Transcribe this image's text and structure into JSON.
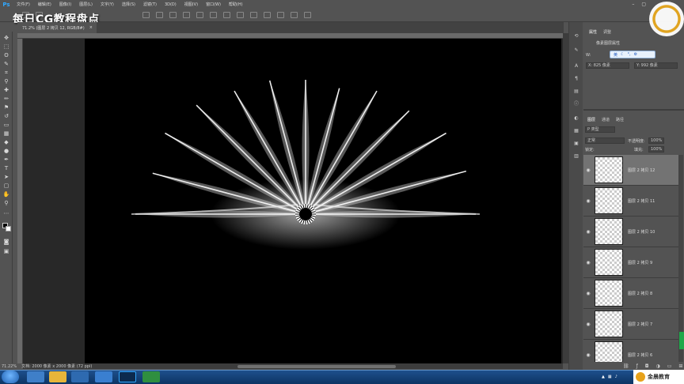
{
  "watermark": "每日CG教程盘点",
  "menubar": {
    "app_icon": "Ps",
    "items": [
      "文件(F)",
      "编辑(E)",
      "图像(I)",
      "图层(L)",
      "文字(Y)",
      "选择(S)",
      "滤镜(T)",
      "3D(D)",
      "视图(V)",
      "窗口(W)",
      "帮助(H)"
    ]
  },
  "document_tab": {
    "title": "71.2% (图层 2 拷贝 12, RGB/8#)",
    "close": "×"
  },
  "statusbar": {
    "zoom": "71.22%",
    "doc_size": "文档: 2000 像素 x 2000 像素 (72 ppi)"
  },
  "properties_panel": {
    "tabs": [
      "属性",
      "调整"
    ],
    "title": "像素图层属性",
    "w_label": "W:",
    "x_value": "X: 825 像素",
    "y_value": "Y: 992 像素"
  },
  "ime_bar": {
    "label": "英"
  },
  "layers_panel": {
    "tabs": [
      "图层",
      "通道",
      "路径"
    ],
    "filter": "P 类型",
    "blend_mode": "正常",
    "opacity_label": "不透明度:",
    "opacity_value": "100%",
    "lock_label": "锁定:",
    "fill_label": "填充:",
    "fill_value": "100%",
    "layers": [
      {
        "name": "图层 2 拷贝 12",
        "selected": true
      },
      {
        "name": "图层 2 拷贝 11",
        "selected": false
      },
      {
        "name": "图层 2 拷贝 10",
        "selected": false
      },
      {
        "name": "图层 2 拷贝 9",
        "selected": false
      },
      {
        "name": "图层 2 拷贝 8",
        "selected": false
      },
      {
        "name": "图层 2 拷贝 7",
        "selected": false
      },
      {
        "name": "图层 2 拷贝 6",
        "selected": false
      }
    ]
  },
  "brand": {
    "name": "金晨教育"
  },
  "colors": {
    "ui_bg": "#535353",
    "canvas": "#000000",
    "accent": "#31a8ff",
    "taskbar": "#1d4f8c"
  }
}
